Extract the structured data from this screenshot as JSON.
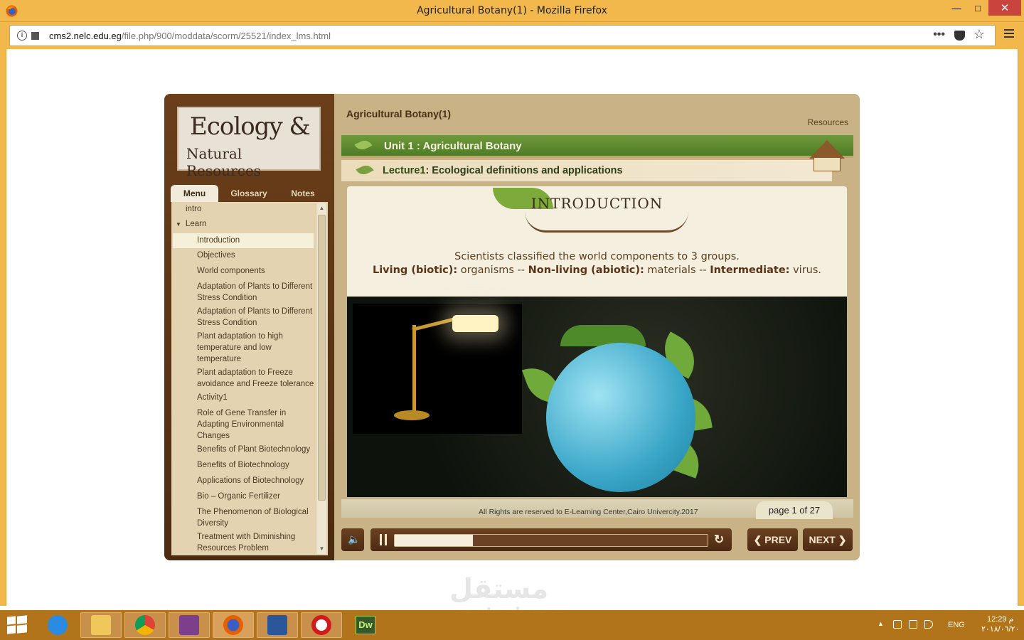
{
  "window": {
    "title": "Agricultural Botany(1) - Mozilla Firefox",
    "minimize": "—",
    "maximize": "□",
    "close": "✕"
  },
  "address": {
    "url_host": "cms2.nelc.edu.eg",
    "url_path": "/file.php/900/moddata/scorm/25521/index_lms.html",
    "more": "•••",
    "star": "☆"
  },
  "course": {
    "logo_line1": "Ecology &",
    "logo_line2": "Natural Resources",
    "title": "Agricultural Botany(1)",
    "resources": "Resources",
    "unit": "Unit 1 : Agricultural Botany",
    "lecture_label": "Lecture1",
    "lecture_title": ": Ecological definitions and applications"
  },
  "tabs": [
    "Menu",
    "Glossary",
    "Notes"
  ],
  "menu": [
    {
      "label": "intro"
    },
    {
      "label": "Learn",
      "arrow": "▼"
    },
    {
      "label": "Introduction",
      "selected": true
    },
    {
      "label": "Objectives"
    },
    {
      "label": "World components"
    },
    {
      "label": "Adaptation of Plants to Different Stress Condition"
    },
    {
      "label": "Adaptation of Plants to Different Stress Condition"
    },
    {
      "label": "Plant adaptation to high temperature and low temperature"
    },
    {
      "label": "Plant adaptation to Freeze avoidance and Freeze tolerance"
    },
    {
      "label": "Activity1"
    },
    {
      "label": "Role of Gene Transfer in Adapting Environmental Changes"
    },
    {
      "label": "Benefits of Plant Biotechnology"
    },
    {
      "label": "Benefits of Biotechnology"
    },
    {
      "label": "Applications of Biotechnology"
    },
    {
      "label": "Bio – Organic Fertilizer"
    },
    {
      "label": "The Phenomenon of Biological Diversity"
    },
    {
      "label": "Treatment with Diminishing Resources Problem"
    }
  ],
  "slide": {
    "heading": "INTRODUCTION",
    "line1": "Scientists classified the world components to 3 groups.",
    "living_label": "Living (biotic):",
    "living_value": " organisms  --  ",
    "nonliving_label": "Non-living (abiotic):",
    "nonliving_value": " materials  -- ",
    "intermediate_label": "Intermediate:",
    "intermediate_value": " virus."
  },
  "footer": {
    "copyright": "All Rights are reserved to E-Learning Center,Cairo Univercity.2017",
    "page": "page 1 of 27"
  },
  "controls": {
    "sound_icon": "speaker-icon",
    "progress": 0.25,
    "prev": "❮ PREV",
    "next": "NEXT ❯",
    "replay": "↻"
  },
  "watermark": {
    "line1": "مستقل",
    "line2": "mostaql.com"
  },
  "taskbar": {
    "apps": [
      "ie-icon",
      "explorer-icon",
      "chrome-icon",
      "winrar-icon",
      "firefox-icon",
      "word-icon",
      "opera-icon",
      "dreamweaver-icon"
    ],
    "dw_label": "Dw",
    "lang": "ENG",
    "time": "12:29 م",
    "date": "٢٠١٨/٠٦/٢٠"
  }
}
